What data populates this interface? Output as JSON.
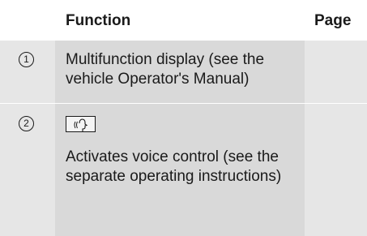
{
  "table": {
    "headers": {
      "number": "",
      "function": "Function",
      "page": "Page"
    },
    "rows": [
      {
        "number": "1",
        "function": "Multifunction display (see the vehicle Operator's Manual)",
        "page": ""
      },
      {
        "number": "2",
        "icon": "voice-control-button-icon",
        "function": "Activates voice control (see the separate operating instructions)",
        "page": ""
      }
    ]
  }
}
